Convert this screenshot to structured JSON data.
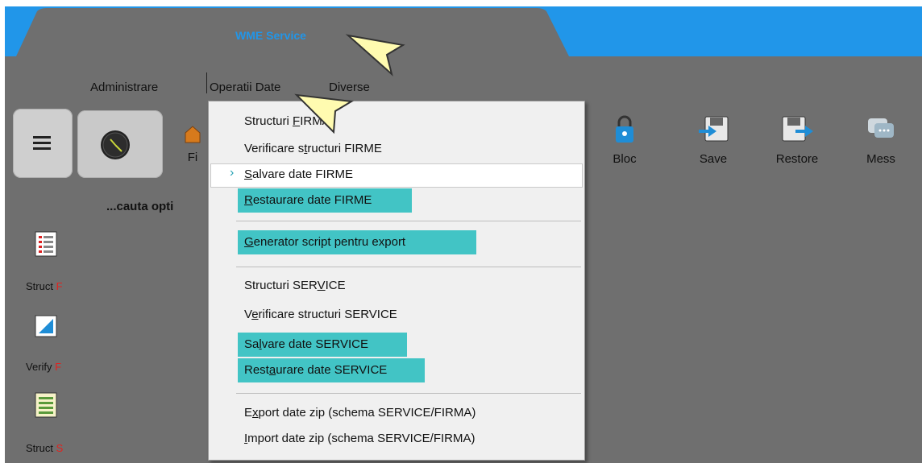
{
  "window": {
    "title": "WME Service"
  },
  "menubar": {
    "items": [
      "Administrare",
      "Operatii Date",
      "Diverse"
    ]
  },
  "toolbar": {
    "buttons": [
      {
        "label": "Fi",
        "icon": "home-icon"
      },
      {
        "label": "Bloc",
        "icon": "lock-icon"
      },
      {
        "label": "Save",
        "icon": "floppy-save-icon"
      },
      {
        "label": "Restore",
        "icon": "floppy-restore-icon"
      },
      {
        "label": "Mess",
        "icon": "message-icon"
      }
    ]
  },
  "search": {
    "text": "...cauta opti"
  },
  "left_panel": {
    "items": [
      {
        "label": "Struct",
        "suffix": "F",
        "icon": "structure-icon"
      },
      {
        "label": "Verify",
        "suffix": "F",
        "icon": "verify-icon"
      },
      {
        "label": "Struct",
        "suffix": "S",
        "icon": "structure-icon"
      }
    ]
  },
  "dropdown": {
    "items": [
      {
        "pre": "Structuri ",
        "ul": "F",
        "post": "IRMA"
      },
      {
        "pre": "Verificare s",
        "ul": "t",
        "post": "ructuri FIRME"
      },
      {
        "pre": "",
        "ul": "S",
        "post": "alvare date FIRME"
      },
      {
        "pre": "",
        "ul": "R",
        "post": "estaurare date FIRME"
      },
      {
        "pre": "",
        "ul": "G",
        "post": "enerator script pentru export"
      },
      {
        "pre": "Structuri SER",
        "ul": "V",
        "post": "ICE"
      },
      {
        "pre": "V",
        "ul": "e",
        "post": "rificare structuri SERVICE"
      },
      {
        "pre": "Sa",
        "ul": "l",
        "post": "vare date SERVICE"
      },
      {
        "pre": "Rest",
        "ul": "a",
        "post": "urare date SERVICE"
      },
      {
        "pre": "E",
        "ul": "x",
        "post": "port date zip (schema SERVICE/FIRMA)"
      },
      {
        "pre": "",
        "ul": "I",
        "post": "mport date zip (schema SERVICE/FIRMA)"
      }
    ]
  },
  "colors": {
    "accent": "#2196e9",
    "highlight": "#42c4c5",
    "red": "#e2221e"
  }
}
